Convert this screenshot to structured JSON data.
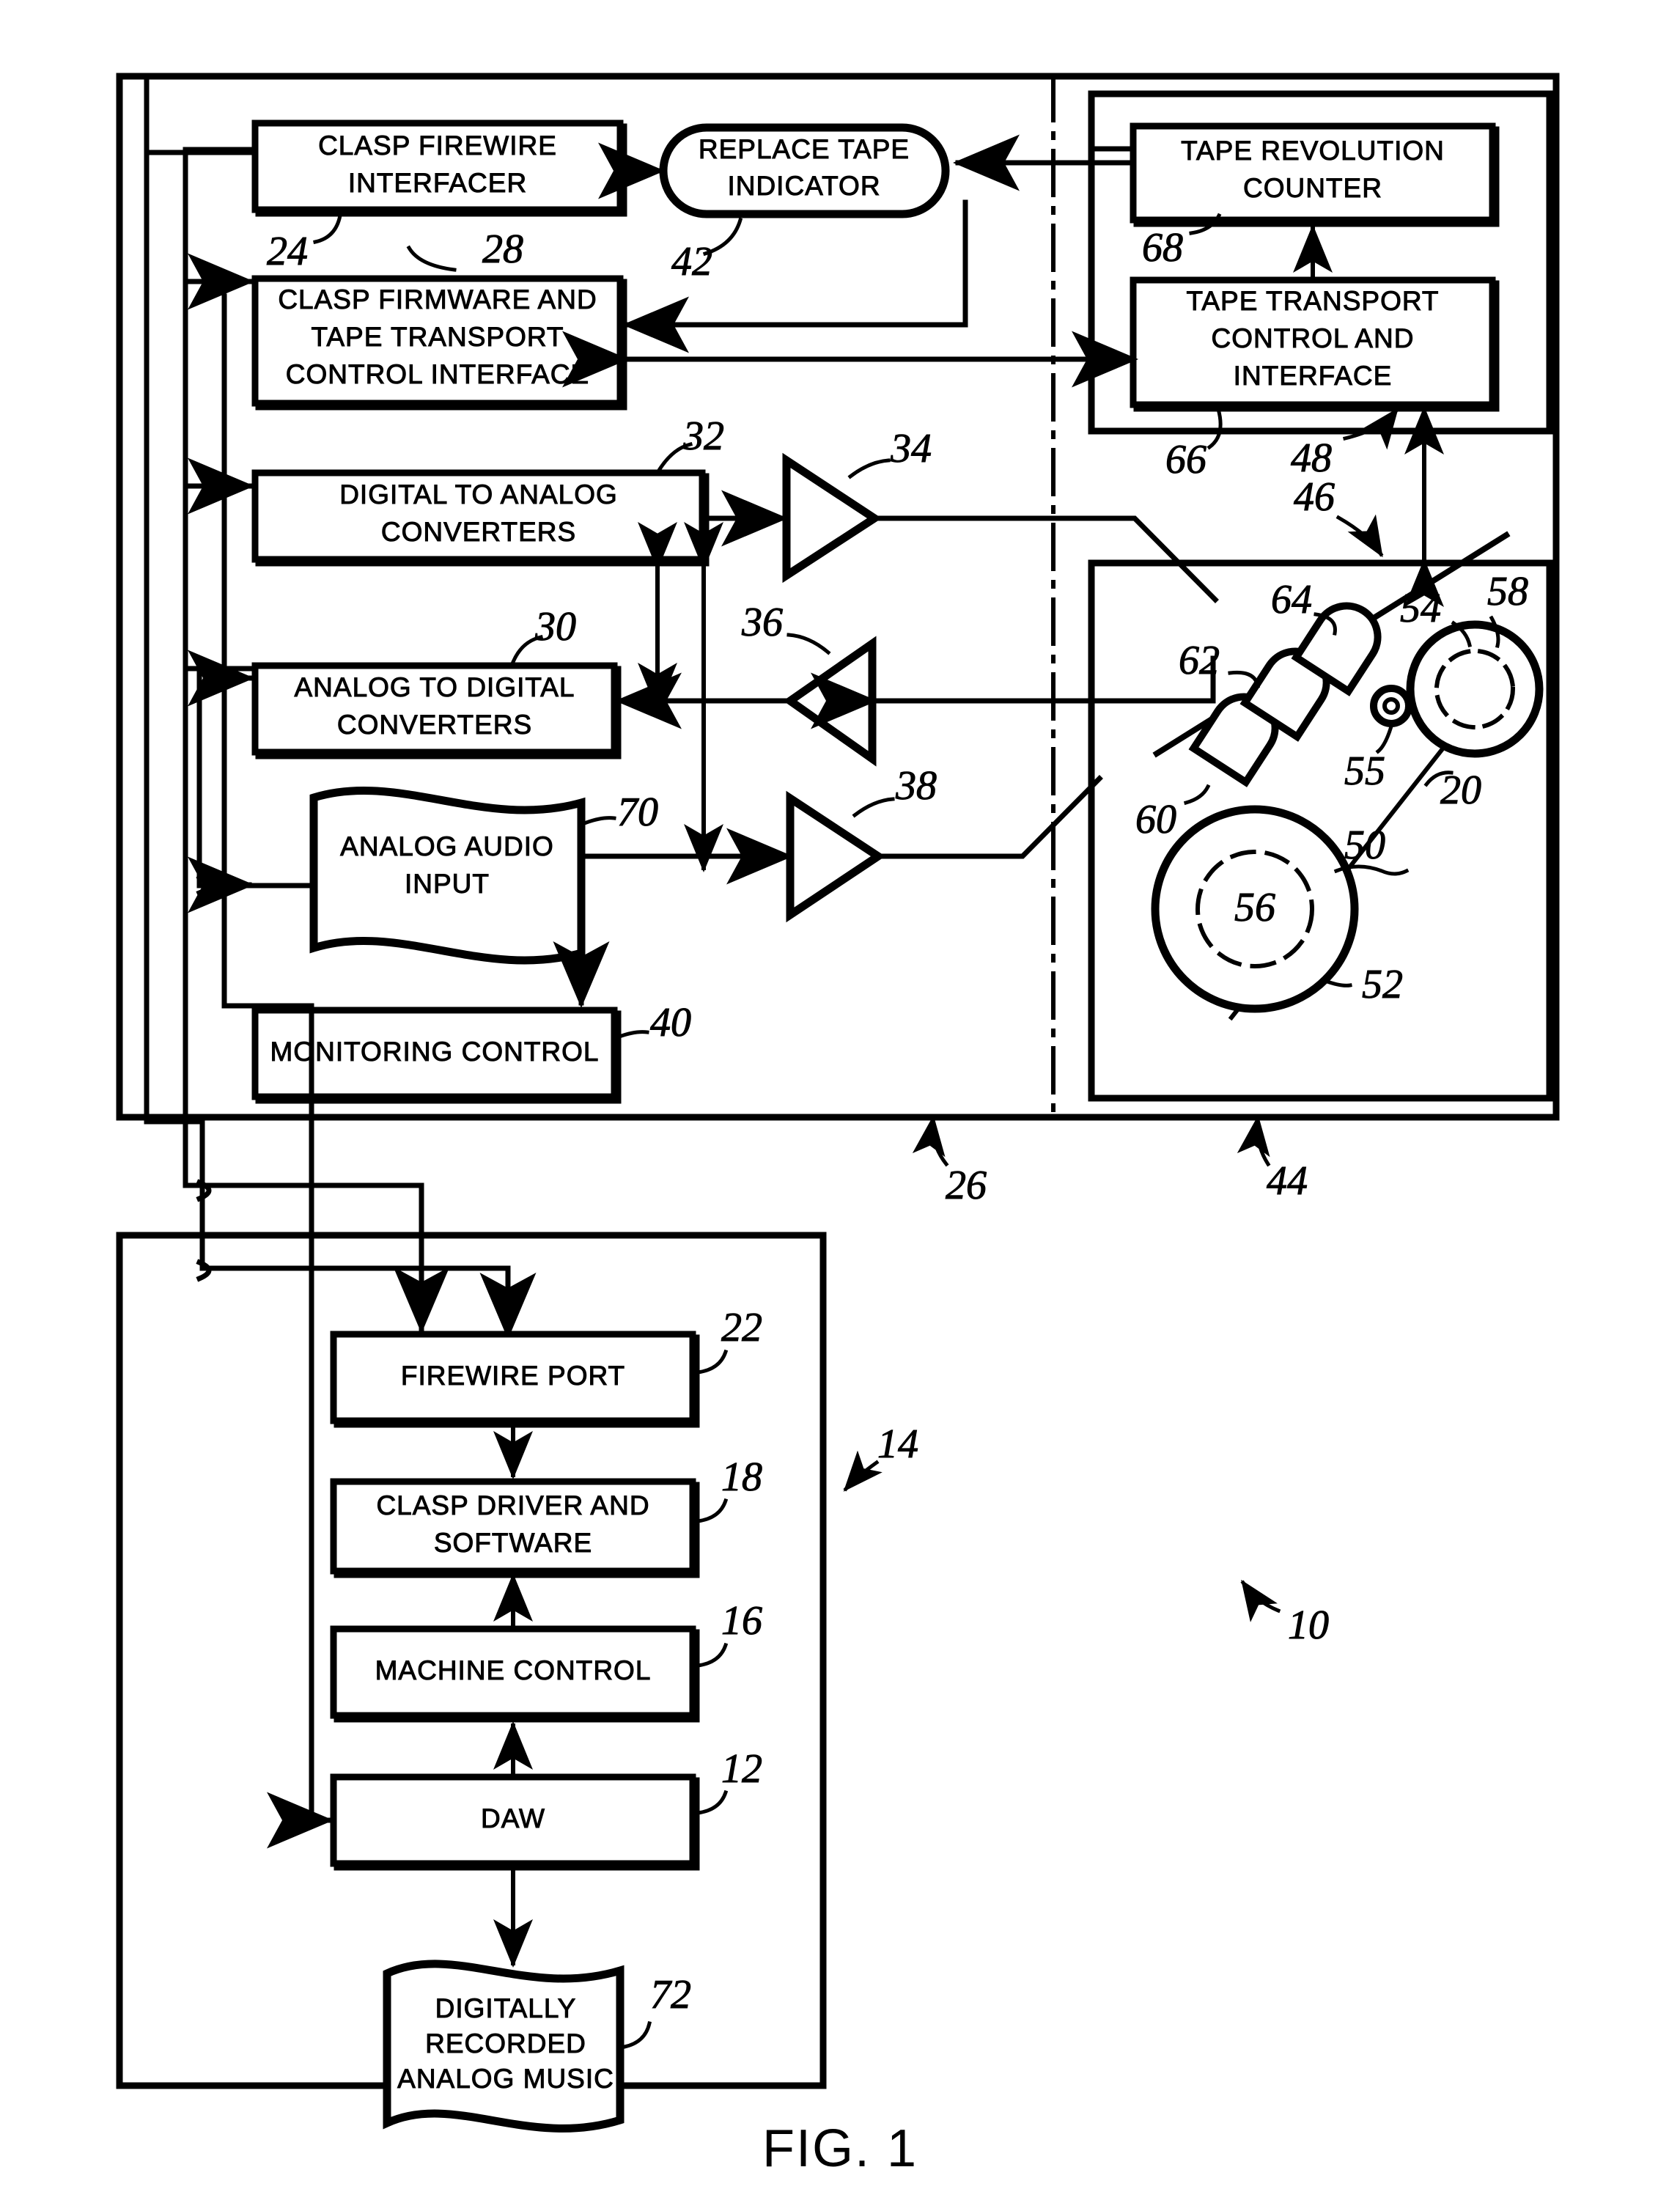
{
  "figure": {
    "caption": "FIG. 1",
    "system_ref": "10"
  },
  "boxes": {
    "clasp_firewire_interfacer": {
      "lines": [
        "CLASP  FIREWIRE",
        "INTERFACER"
      ],
      "ref": "24"
    },
    "clasp_firmware_tape_transport": {
      "lines": [
        "CLASP FIRMWARE AND",
        "TAPE TRANSPORT",
        "CONTROL INTERFACE"
      ],
      "ref": "28"
    },
    "replace_tape_indicator": {
      "lines": [
        "REPLACE TAPE",
        "INDICATOR"
      ],
      "ref": "42"
    },
    "tape_revolution_counter": {
      "lines": [
        "TAPE REVOLUTION",
        "COUNTER"
      ],
      "ref": "68"
    },
    "tape_transport_control_interface": {
      "lines": [
        "TAPE TRANSPORT",
        "CONTROL AND",
        "INTERFACE"
      ],
      "ref": "66"
    },
    "digital_to_analog_converters": {
      "lines": [
        "DIGITAL TO ANALOG",
        "CONVERTERS"
      ],
      "ref": "32"
    },
    "analog_to_digital_converters": {
      "lines": [
        "ANALOG TO DIGITAL",
        "CONVERTERS"
      ],
      "ref": "30"
    },
    "analog_audio_input": {
      "lines": [
        "ANALOG AUDIO",
        "INPUT"
      ],
      "ref": "70"
    },
    "monitoring_control": {
      "lines": [
        "MONITORING CONTROL"
      ],
      "ref": "40"
    },
    "firewire_port": {
      "lines": [
        "FIREWIRE PORT"
      ],
      "ref": "22"
    },
    "clasp_driver_and_software": {
      "lines": [
        "CLASP DRIVER AND",
        "SOFTWARE"
      ],
      "ref": "18"
    },
    "machine_control": {
      "lines": [
        "MACHINE CONTROL"
      ],
      "ref": "16"
    },
    "daw": {
      "lines": [
        "DAW"
      ],
      "ref": "12"
    },
    "digitally_recorded_analog_music": {
      "lines": [
        "DIGITALLY",
        "RECORDED",
        "ANALOG MUSIC"
      ],
      "ref": "72"
    }
  },
  "amplifiers": {
    "playback_amp": {
      "ref": "34"
    },
    "repro_amp": {
      "ref": "36"
    },
    "record_amp": {
      "ref": "38"
    }
  },
  "enclosures": {
    "clasp_unit": {
      "ref": "26"
    },
    "tape_machine": {
      "ref": "44"
    },
    "computer": {
      "ref": "14"
    },
    "transport_deck": {
      "ref": "50"
    }
  },
  "transport": {
    "supply_reel": {
      "ref": "52"
    },
    "supply_hub": {
      "ref": "56"
    },
    "takeup_reel": {
      "ref": "58"
    },
    "takeup_hub": {
      "ref": "54"
    },
    "capstan": {
      "ref": "55"
    },
    "erase_head": {
      "ref": "60"
    },
    "record_head": {
      "ref": "62"
    },
    "repro_head": {
      "ref": "64"
    },
    "tape": {
      "ref": "20"
    },
    "transport_link": {
      "ref": "46"
    },
    "counter_link": {
      "ref": "48"
    }
  }
}
